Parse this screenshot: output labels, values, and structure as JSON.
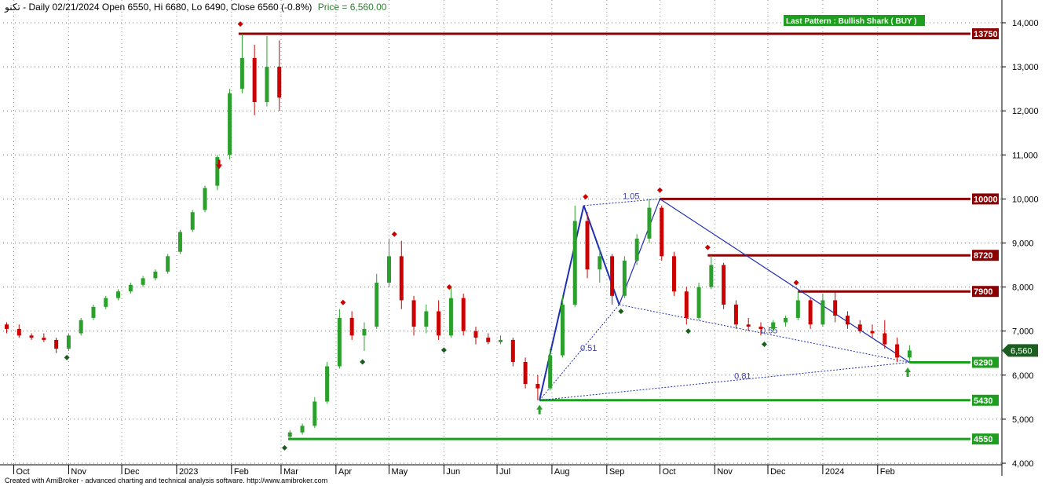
{
  "header": {
    "title": "تكنو - Daily 02/21/2024 Open 6550, Hi 6680, Lo 6490, Close 6560 (-0.8%)",
    "price": "Price = 6,560.00"
  },
  "footer": {
    "credit": "Created with AmiBroker - advanced charting and technical analysis software. http://www.amibroker.com"
  },
  "pattern_badge": "Last Pattern : Bullish Shark ( BUY )",
  "colors": {
    "bullish": "#2ca02c",
    "bearish": "#cc0000",
    "resistance": "#8b0000",
    "support": "#1e9e1e",
    "pattern_line": "#1f2fb3",
    "last_price_bg": "#1b5e20"
  },
  "chart_data": {
    "type": "candlestick",
    "ylim": [
      4000,
      14500
    ],
    "y_ticks": [
      4000,
      5000,
      6000,
      7000,
      8000,
      9000,
      10000,
      11000,
      12000,
      13000,
      14000
    ],
    "y_tick_labels": [
      "4,000",
      "5,000",
      "6,000",
      "7,000",
      "8,000",
      "9,000",
      "10,000",
      "11,000",
      "12,000",
      "13,000",
      "14,000"
    ],
    "x_labels": [
      {
        "label": "Oct",
        "date": "2022-10-01"
      },
      {
        "label": "Nov",
        "date": "2022-11-01"
      },
      {
        "label": "Dec",
        "date": "2022-12-01"
      },
      {
        "label": "2023",
        "date": "2023-01-01"
      },
      {
        "label": "Feb",
        "date": "2023-02-01"
      },
      {
        "label": "Mar",
        "date": "2023-03-01"
      },
      {
        "label": "Apr",
        "date": "2023-04-01"
      },
      {
        "label": "May",
        "date": "2023-05-01"
      },
      {
        "label": "Jun",
        "date": "2023-06-01"
      },
      {
        "label": "Jul",
        "date": "2023-07-01"
      },
      {
        "label": "Aug",
        "date": "2023-08-01"
      },
      {
        "label": "Sep",
        "date": "2023-09-01"
      },
      {
        "label": "Oct",
        "date": "2023-10-01"
      },
      {
        "label": "Nov",
        "date": "2023-11-01"
      },
      {
        "label": "Dec",
        "date": "2023-12-01"
      },
      {
        "label": "2024",
        "date": "2024-01-01"
      },
      {
        "label": "Feb",
        "date": "2024-02-01"
      }
    ],
    "last_price": {
      "value": 6560,
      "label": "6,560"
    },
    "levels": [
      {
        "value": 13750,
        "label": "13750",
        "kind": "resistance",
        "from": "2023-02-05"
      },
      {
        "value": 10000,
        "label": "10000",
        "kind": "resistance",
        "from": "2023-10-01"
      },
      {
        "value": 8720,
        "label": "8720",
        "kind": "resistance",
        "from": "2023-10-28"
      },
      {
        "value": 7900,
        "label": "7900",
        "kind": "resistance",
        "from": "2023-12-18"
      },
      {
        "value": 6290,
        "label": "6290",
        "kind": "support",
        "from": "2024-02-19"
      },
      {
        "value": 5430,
        "label": "5430",
        "kind": "support",
        "from": "2023-07-25"
      },
      {
        "value": 4550,
        "label": "4550",
        "kind": "support",
        "from": "2023-03-05"
      }
    ],
    "pattern": {
      "name": "Bullish Shark",
      "points": [
        {
          "date": "2023-07-25",
          "value": 5430
        },
        {
          "date": "2023-08-19",
          "value": 9850
        },
        {
          "date": "2023-09-08",
          "value": 7600
        },
        {
          "date": "2023-10-01",
          "value": 10000
        },
        {
          "date": "2024-02-19",
          "value": 6290
        }
      ],
      "ratios": [
        {
          "label": "1.05",
          "date": "2023-09-10",
          "value": 10000
        },
        {
          "label": "0.51",
          "date": "2023-08-17",
          "value": 6550
        },
        {
          "label": "0.55",
          "date": "2023-11-27",
          "value": 6950
        },
        {
          "label": "0.81",
          "date": "2023-11-12",
          "value": 5920
        }
      ]
    },
    "markers": [
      {
        "date": "2023-02-06",
        "value": 13970,
        "kind": "high"
      },
      {
        "date": "2023-05-04",
        "value": 9200,
        "kind": "high"
      },
      {
        "date": "2023-04-05",
        "value": 7650,
        "kind": "high"
      },
      {
        "date": "2023-06-04",
        "value": 8000,
        "kind": "high"
      },
      {
        "date": "2023-08-20",
        "value": 10050,
        "kind": "high"
      },
      {
        "date": "2023-10-01",
        "value": 10200,
        "kind": "high"
      },
      {
        "date": "2023-10-28",
        "value": 8900,
        "kind": "high"
      },
      {
        "date": "2023-12-17",
        "value": 8100,
        "kind": "high"
      },
      {
        "date": "2022-10-31",
        "value": 6400,
        "kind": "low"
      },
      {
        "date": "2023-03-03",
        "value": 4350,
        "kind": "low"
      },
      {
        "date": "2023-04-16",
        "value": 6300,
        "kind": "low"
      },
      {
        "date": "2023-06-01",
        "value": 6570,
        "kind": "low"
      },
      {
        "date": "2023-09-09",
        "value": 7450,
        "kind": "low"
      },
      {
        "date": "2023-10-17",
        "value": 7000,
        "kind": "low"
      },
      {
        "date": "2023-11-29",
        "value": 6700,
        "kind": "low"
      }
    ],
    "signals": [
      {
        "date": "2023-01-25",
        "value": 10800,
        "kind": "sell"
      },
      {
        "date": "2023-07-25",
        "value": 5200,
        "kind": "buy"
      },
      {
        "date": "2024-02-18",
        "value": 6050,
        "kind": "buy"
      }
    ],
    "candles": [
      {
        "date": "2022-09-27",
        "open": 7150,
        "high": 7200,
        "low": 6950,
        "close": 7050
      },
      {
        "date": "2022-10-04",
        "open": 7050,
        "high": 7150,
        "low": 6850,
        "close": 6900
      },
      {
        "date": "2022-10-11",
        "open": 6900,
        "high": 6950,
        "low": 6800,
        "close": 6850
      },
      {
        "date": "2022-10-18",
        "open": 6850,
        "high": 6950,
        "low": 6750,
        "close": 6800
      },
      {
        "date": "2022-10-25",
        "open": 6800,
        "high": 6850,
        "low": 6500,
        "close": 6600
      },
      {
        "date": "2022-11-01",
        "open": 6600,
        "high": 6950,
        "low": 6550,
        "close": 6900
      },
      {
        "date": "2022-11-08",
        "open": 6950,
        "high": 7300,
        "low": 6900,
        "close": 7250
      },
      {
        "date": "2022-11-15",
        "open": 7300,
        "high": 7600,
        "low": 7250,
        "close": 7550
      },
      {
        "date": "2022-11-22",
        "open": 7550,
        "high": 7800,
        "low": 7500,
        "close": 7750
      },
      {
        "date": "2022-11-29",
        "open": 7750,
        "high": 7950,
        "low": 7700,
        "close": 7900
      },
      {
        "date": "2022-12-06",
        "open": 7900,
        "high": 8100,
        "low": 7850,
        "close": 8050
      },
      {
        "date": "2022-12-13",
        "open": 8050,
        "high": 8250,
        "low": 8000,
        "close": 8200
      },
      {
        "date": "2022-12-20",
        "open": 8200,
        "high": 8400,
        "low": 8150,
        "close": 8350
      },
      {
        "date": "2022-12-27",
        "open": 8350,
        "high": 8750,
        "low": 8300,
        "close": 8700
      },
      {
        "date": "2023-01-03",
        "open": 8800,
        "high": 9300,
        "low": 8750,
        "close": 9250
      },
      {
        "date": "2023-01-10",
        "open": 9300,
        "high": 9750,
        "low": 9250,
        "close": 9700
      },
      {
        "date": "2023-01-17",
        "open": 9750,
        "high": 10300,
        "low": 9700,
        "close": 10250
      },
      {
        "date": "2023-01-24",
        "open": 10300,
        "high": 11000,
        "low": 10200,
        "close": 10950
      },
      {
        "date": "2023-01-31",
        "open": 11000,
        "high": 12500,
        "low": 10900,
        "close": 12400
      },
      {
        "date": "2023-02-07",
        "open": 12500,
        "high": 13750,
        "low": 12400,
        "close": 13200
      },
      {
        "date": "2023-02-14",
        "open": 13200,
        "high": 13500,
        "low": 11900,
        "close": 12200
      },
      {
        "date": "2023-02-21",
        "open": 12200,
        "high": 13700,
        "low": 12100,
        "close": 13000
      },
      {
        "date": "2023-02-28",
        "open": 13000,
        "high": 13600,
        "low": 12000,
        "close": 12300
      },
      {
        "date": "2023-03-06",
        "open": 4600,
        "high": 4750,
        "low": 4550,
        "close": 4700
      },
      {
        "date": "2023-03-13",
        "open": 4700,
        "high": 4900,
        "low": 4650,
        "close": 4850
      },
      {
        "date": "2023-03-20",
        "open": 4850,
        "high": 5500,
        "low": 4800,
        "close": 5400
      },
      {
        "date": "2023-03-27",
        "open": 5400,
        "high": 6300,
        "low": 5350,
        "close": 6200
      },
      {
        "date": "2023-04-03",
        "open": 6200,
        "high": 7500,
        "low": 6150,
        "close": 7300
      },
      {
        "date": "2023-04-10",
        "open": 7300,
        "high": 7450,
        "low": 6800,
        "close": 6900
      },
      {
        "date": "2023-04-17",
        "open": 6900,
        "high": 7200,
        "low": 6550,
        "close": 7050
      },
      {
        "date": "2023-04-24",
        "open": 7100,
        "high": 8300,
        "low": 7050,
        "close": 8100
      },
      {
        "date": "2023-05-01",
        "open": 8100,
        "high": 9100,
        "low": 8000,
        "close": 8700
      },
      {
        "date": "2023-05-08",
        "open": 8700,
        "high": 9050,
        "low": 7500,
        "close": 7700
      },
      {
        "date": "2023-05-15",
        "open": 7700,
        "high": 7800,
        "low": 6900,
        "close": 7100
      },
      {
        "date": "2023-05-22",
        "open": 7100,
        "high": 7600,
        "low": 6950,
        "close": 7450
      },
      {
        "date": "2023-05-29",
        "open": 7450,
        "high": 7700,
        "low": 6800,
        "close": 6900
      },
      {
        "date": "2023-06-05",
        "open": 6900,
        "high": 8000,
        "low": 6850,
        "close": 7750
      },
      {
        "date": "2023-06-12",
        "open": 7750,
        "high": 7850,
        "low": 6900,
        "close": 7000
      },
      {
        "date": "2023-06-19",
        "open": 7000,
        "high": 7100,
        "low": 6700,
        "close": 6850
      },
      {
        "date": "2023-06-26",
        "open": 6850,
        "high": 6950,
        "low": 6700,
        "close": 6750
      },
      {
        "date": "2023-07-03",
        "open": 6750,
        "high": 6900,
        "low": 6700,
        "close": 6800
      },
      {
        "date": "2023-07-10",
        "open": 6800,
        "high": 6850,
        "low": 6200,
        "close": 6300
      },
      {
        "date": "2023-07-17",
        "open": 6300,
        "high": 6400,
        "low": 5700,
        "close": 5800
      },
      {
        "date": "2023-07-24",
        "open": 5800,
        "high": 6000,
        "low": 5430,
        "close": 5700
      },
      {
        "date": "2023-07-31",
        "open": 5700,
        "high": 6600,
        "low": 5650,
        "close": 6450
      },
      {
        "date": "2023-08-07",
        "open": 6450,
        "high": 7800,
        "low": 6400,
        "close": 7600
      },
      {
        "date": "2023-08-14",
        "open": 7600,
        "high": 9850,
        "low": 7550,
        "close": 9500
      },
      {
        "date": "2023-08-21",
        "open": 9500,
        "high": 9700,
        "low": 8200,
        "close": 8400
      },
      {
        "date": "2023-08-28",
        "open": 8400,
        "high": 8900,
        "low": 8100,
        "close": 8700
      },
      {
        "date": "2023-09-04",
        "open": 8700,
        "high": 8750,
        "low": 7600,
        "close": 7800
      },
      {
        "date": "2023-09-11",
        "open": 7800,
        "high": 8700,
        "low": 7750,
        "close": 8600
      },
      {
        "date": "2023-09-18",
        "open": 8600,
        "high": 9200,
        "low": 8500,
        "close": 9100
      },
      {
        "date": "2023-09-25",
        "open": 9100,
        "high": 10000,
        "low": 9000,
        "close": 9800
      },
      {
        "date": "2023-10-02",
        "open": 9800,
        "high": 9850,
        "low": 8600,
        "close": 8700
      },
      {
        "date": "2023-10-09",
        "open": 8700,
        "high": 8800,
        "low": 7800,
        "close": 7900
      },
      {
        "date": "2023-10-16",
        "open": 7900,
        "high": 8000,
        "low": 7150,
        "close": 7300
      },
      {
        "date": "2023-10-23",
        "open": 7300,
        "high": 8100,
        "low": 7250,
        "close": 8000
      },
      {
        "date": "2023-10-30",
        "open": 8000,
        "high": 8720,
        "low": 7950,
        "close": 8500
      },
      {
        "date": "2023-11-06",
        "open": 8500,
        "high": 8550,
        "low": 7500,
        "close": 7600
      },
      {
        "date": "2023-11-13",
        "open": 7600,
        "high": 7700,
        "low": 7050,
        "close": 7150
      },
      {
        "date": "2023-11-20",
        "open": 7150,
        "high": 7300,
        "low": 7000,
        "close": 7100
      },
      {
        "date": "2023-11-27",
        "open": 7100,
        "high": 7200,
        "low": 6900,
        "close": 7050
      },
      {
        "date": "2023-12-04",
        "open": 7050,
        "high": 7250,
        "low": 7000,
        "close": 7200
      },
      {
        "date": "2023-12-11",
        "open": 7200,
        "high": 7350,
        "low": 7100,
        "close": 7300
      },
      {
        "date": "2023-12-18",
        "open": 7300,
        "high": 7900,
        "low": 7250,
        "close": 7700
      },
      {
        "date": "2023-12-25",
        "open": 7700,
        "high": 7750,
        "low": 7050,
        "close": 7150
      },
      {
        "date": "2024-01-01",
        "open": 7150,
        "high": 7850,
        "low": 7100,
        "close": 7700
      },
      {
        "date": "2024-01-08",
        "open": 7700,
        "high": 7900,
        "low": 7200,
        "close": 7350
      },
      {
        "date": "2024-01-15",
        "open": 7350,
        "high": 7450,
        "low": 7050,
        "close": 7150
      },
      {
        "date": "2024-01-22",
        "open": 7150,
        "high": 7250,
        "low": 6950,
        "close": 7000
      },
      {
        "date": "2024-01-29",
        "open": 7000,
        "high": 7150,
        "low": 6850,
        "close": 6950
      },
      {
        "date": "2024-02-05",
        "open": 6950,
        "high": 7250,
        "low": 6600,
        "close": 6700
      },
      {
        "date": "2024-02-12",
        "open": 6700,
        "high": 6850,
        "low": 6300,
        "close": 6400
      },
      {
        "date": "2024-02-19",
        "open": 6400,
        "high": 6680,
        "low": 6290,
        "close": 6560
      }
    ]
  }
}
